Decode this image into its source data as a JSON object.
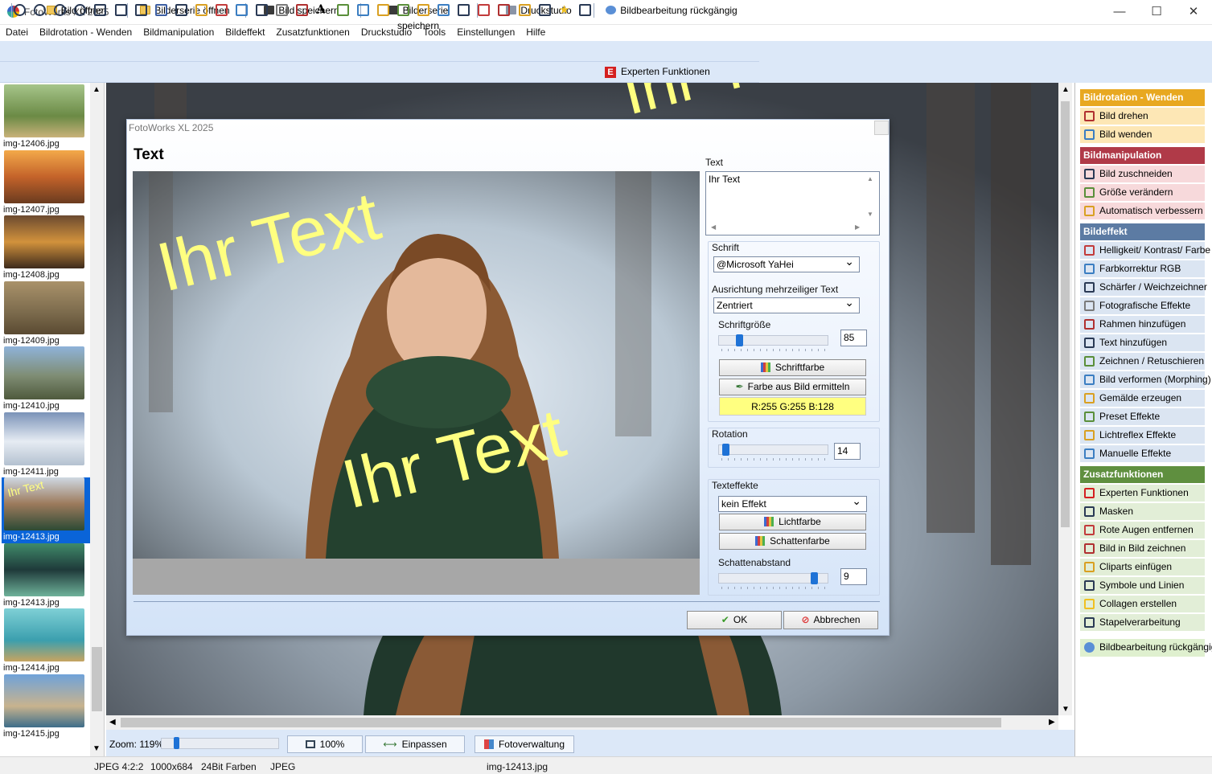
{
  "app": {
    "title": "FotoWorks XL 2025",
    "window_controls": [
      "minimize-icon",
      "maximize-icon",
      "close-icon"
    ]
  },
  "menu": [
    "Datei",
    "Bildrotation - Wenden",
    "Bildmanipulation",
    "Bildeffekt",
    "Zusatzfunktionen",
    "Druckstudio",
    "Tools",
    "Einstellungen",
    "Hilfe"
  ],
  "toolbar1": {
    "open": "Bild öffnen",
    "open_series": "Bilderserie öffnen",
    "save": "Bild speichern",
    "save_series": "Bilderserie speichern",
    "print": "Druckstudio",
    "undo": "Bildbearbeitung rückgängig"
  },
  "toolbar2": {
    "expert": "Experten Funktionen",
    "expert_glyph": "E"
  },
  "thumbnails": [
    {
      "label": "img-12406.jpg"
    },
    {
      "label": "img-12407.jpg"
    },
    {
      "label": "img-12408.jpg"
    },
    {
      "label": "img-12409.jpg"
    },
    {
      "label": "img-12410.jpg"
    },
    {
      "label": "img-12411.jpg"
    },
    {
      "label": "img-12413.jpg",
      "overlay": "Ihr Text",
      "selected": true
    },
    {
      "label": "img-12413.jpg"
    },
    {
      "label": "img-12414.jpg"
    },
    {
      "label": "img-12415.jpg"
    }
  ],
  "zoom": {
    "label": "Zoom: 119%",
    "btn_100": "100%",
    "btn_fit": "Einpassen",
    "btn_manager": "Fotoverwaltung"
  },
  "status": {
    "format": "JPEG  4:2:2",
    "size": "1000x684",
    "depth": "24Bit Farben",
    "type": "JPEG",
    "file": "img-12413.jpg"
  },
  "sidebar": [
    {
      "header": "Bildrotation - Wenden",
      "color": "#e8a821",
      "bg": "#fde7b5",
      "items": [
        "Bild drehen",
        "Bild wenden"
      ]
    },
    {
      "header": "Bildmanipulation",
      "color": "#b03a48",
      "bg": "#f7d9db",
      "items": [
        "Bild zuschneiden",
        "Größe verändern",
        "Automatisch verbessern"
      ]
    },
    {
      "header": "Bildeffekt",
      "color": "#5c7ba3",
      "bg": "#dbe5f2",
      "items": [
        "Helligkeit/ Kontrast/ Farbe",
        "Farbkorrektur RGB",
        "Schärfer / Weichzeichner",
        "Fotografische Effekte",
        "Rahmen hinzufügen",
        "Text hinzufügen",
        "Zeichnen / Retuschieren",
        "Bild verformen (Morphing)",
        "Gemälde erzeugen",
        "Preset Effekte",
        "Lichtreflex Effekte",
        "Manuelle Effekte"
      ]
    },
    {
      "header": "Zusatzfunktionen",
      "color": "#5f8f3f",
      "bg": "#e2eed7",
      "items": [
        "Experten Funktionen",
        "Masken",
        "Rote Augen entfernen",
        "Bild in Bild zeichnen",
        "Cliparts einfügen",
        "Symbole und Linien",
        "Collagen erstellen",
        "Stapelverarbeitung"
      ]
    }
  ],
  "sidebar_undo": "Bildbearbeitung rückgängig",
  "dialog": {
    "title": "FotoWorks XL 2025",
    "heading": "Text",
    "overlay_text": "Ihr Text",
    "text_label": "Text",
    "text_value": "Ihr Text",
    "font_label": "Schrift",
    "font_value": "@Microsoft YaHei",
    "align_label": "Ausrichtung mehrzeiliger Text",
    "align_value": "Zentriert",
    "size_label": "Schriftgröße",
    "size_value": "85",
    "font_color_btn": "Schriftfarbe",
    "pick_color_btn": "Farbe aus Bild ermitteln",
    "color_value": "R:255  G:255  B:128",
    "color_hex": "#ffff80",
    "rotation_label": "Rotation",
    "rotation_value": "14",
    "effects_label": "Texteffekte",
    "effect_value": "kein Effekt",
    "light_color_btn": "Lichtfarbe",
    "shadow_color_btn": "Schattenfarbe",
    "shadow_dist_label": "Schattenabstand",
    "shadow_dist_value": "9",
    "ok": "OK",
    "cancel": "Abbrechen"
  }
}
